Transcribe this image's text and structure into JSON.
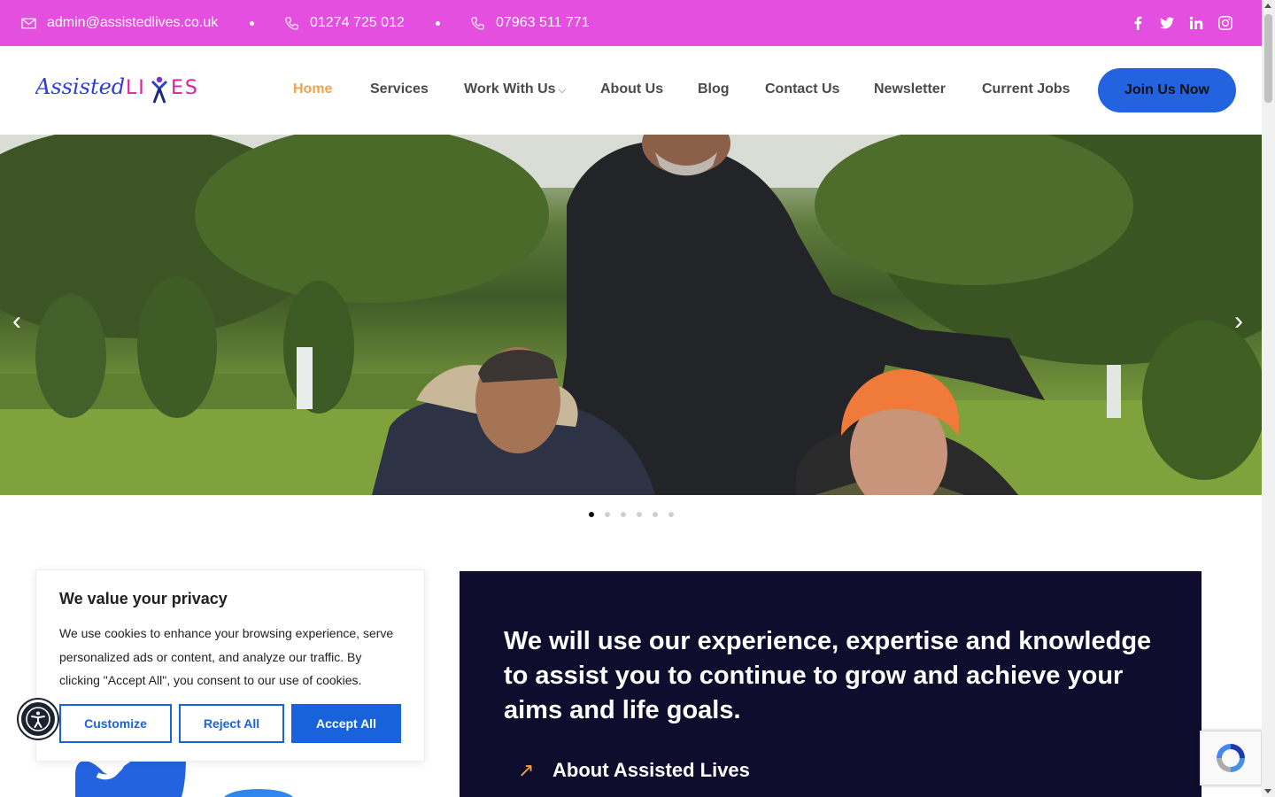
{
  "topbar": {
    "email": "admin@assistedlives.co.uk",
    "phone1": "01274 725 012",
    "phone2": "07963 511 771",
    "social_icons": [
      "facebook-icon",
      "twitter-icon",
      "linkedin-icon",
      "instagram-icon"
    ],
    "background": "#e44fe0"
  },
  "logo": {
    "text_left": "Assisted",
    "text_right": "LIVES"
  },
  "nav": {
    "items": [
      "Home",
      "Services",
      "Work With Us",
      "About Us",
      "Blog",
      "Contact Us",
      "Newsletter",
      "Current Jobs"
    ],
    "active": "Home",
    "join_label": "Join Us Now"
  },
  "hero": {
    "prev_icon": "chevron-left-icon",
    "next_icon": "chevron-right-icon",
    "slides_count": 6,
    "active_slide": 1
  },
  "panel": {
    "heading": "We will use our experience, expertise and knowledge to assist you to continue to grow and achieve your aims and life goals.",
    "about_label": "About Assisted Lives",
    "about_icon": "arrow-up-right-icon"
  },
  "cookie": {
    "title": "We value your privacy",
    "text": "We use cookies to enhance your browsing experience, serve personalized ads or content, and analyze our traffic. By clicking \"Accept All\", you consent to our use of cookies.",
    "customize": "Customize",
    "reject": "Reject All",
    "accept": "Accept All"
  },
  "colors": {
    "accent_blue": "#2463e0",
    "active_nav": "#f5a14a",
    "panel_bg": "#0f0d2e"
  }
}
